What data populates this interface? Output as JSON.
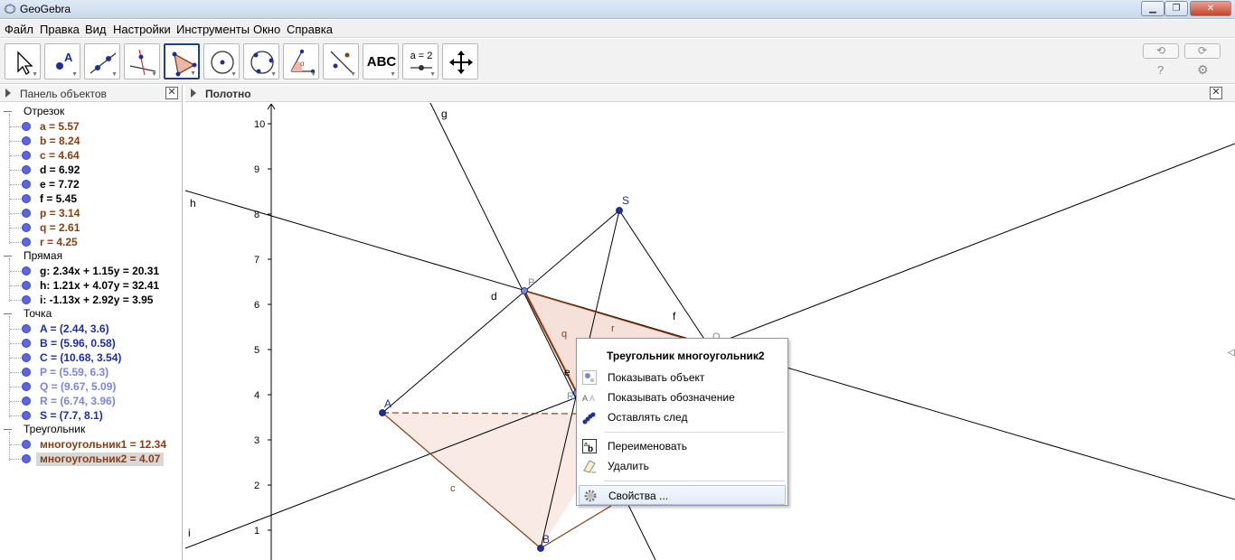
{
  "window": {
    "title": "GeoGebra"
  },
  "menu": [
    "Файл",
    "Правка",
    "Вид",
    "Настройки",
    "Инструменты",
    "Окно",
    "Справка"
  ],
  "toolbar": {
    "text_tool_label": "ABC",
    "slider_tool_label": "a = 2"
  },
  "algebra_panel": {
    "title": "Панель объектов",
    "categories": [
      {
        "name": "Отрезок",
        "items": [
          {
            "text": "a = 5.57",
            "color": "#8a3e10"
          },
          {
            "text": "b = 8.24",
            "color": "#8a3e10"
          },
          {
            "text": "c = 4.64",
            "color": "#8a3e10"
          },
          {
            "text": "d = 6.92",
            "color": "#000000"
          },
          {
            "text": "e = 7.72",
            "color": "#000000"
          },
          {
            "text": "f = 5.45",
            "color": "#000000"
          },
          {
            "text": "p = 3.14",
            "color": "#8a3e10"
          },
          {
            "text": "q = 2.61",
            "color": "#8a3e10"
          },
          {
            "text": "r = 4.25",
            "color": "#8a3e10"
          }
        ]
      },
      {
        "name": "Прямая",
        "items": [
          {
            "text": "g: 2.34x + 1.15y = 20.31",
            "color": "#000000"
          },
          {
            "text": "h: 1.21x + 4.07y = 32.41",
            "color": "#000000"
          },
          {
            "text": "i: -1.13x + 2.92y = 3.95",
            "color": "#000000"
          }
        ]
      },
      {
        "name": "Точка",
        "items": [
          {
            "text": "A = (2.44, 3.6)",
            "color": "#1a2fa8"
          },
          {
            "text": "B = (5.96, 0.58)",
            "color": "#1a2fa8"
          },
          {
            "text": "C = (10.68, 3.54)",
            "color": "#1a2fa8"
          },
          {
            "text": "P = (5.59, 6.3)",
            "color": "#7b86d6"
          },
          {
            "text": "Q = (9.67, 5.09)",
            "color": "#7b86d6"
          },
          {
            "text": "R = (6.74, 3.96)",
            "color": "#7b86d6"
          },
          {
            "text": "S = (7.7, 8.1)",
            "color": "#1a2fa8"
          }
        ]
      },
      {
        "name": "Треугольник",
        "items": [
          {
            "text": "многоугольник1 = 12.34",
            "color": "#8a3e10"
          },
          {
            "text": "многоугольник2 = 4.07",
            "color": "#8a3e10",
            "selected": true
          }
        ]
      }
    ]
  },
  "graphics_panel": {
    "title": "Полотно",
    "y_ticks": [
      "10",
      "9",
      "8",
      "7",
      "6",
      "5",
      "4",
      "3",
      "2",
      "1"
    ],
    "labels": {
      "g": "g",
      "h": "h",
      "i": "i",
      "d": "d",
      "e": "e",
      "f": "f",
      "q": "q",
      "r": "r",
      "c": "c",
      "A": "A",
      "B": "B",
      "S": "S",
      "P": "P",
      "Q": "Q",
      "R": "R"
    }
  },
  "context_menu": {
    "title": "Треугольник многоугольник2",
    "items": [
      {
        "label": "Показывать объект",
        "icon": "show-object-icon"
      },
      {
        "label": "Показывать обозначение",
        "icon": "show-label-icon"
      },
      {
        "label": "Оставлять след",
        "icon": "trace-icon"
      },
      {
        "label": "Переименовать",
        "icon": "rename-icon"
      },
      {
        "label": "Удалить",
        "icon": "eraser-icon"
      },
      {
        "label": "Свойства ...",
        "icon": "gear-icon"
      }
    ]
  }
}
